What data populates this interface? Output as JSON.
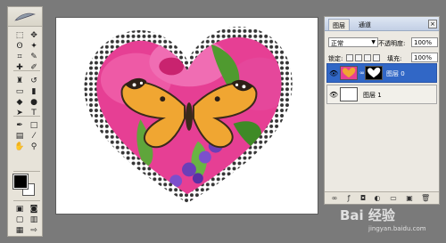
{
  "tools_panel": {
    "tools": [
      {
        "name": "marquee-tool",
        "glyph": "⬚"
      },
      {
        "name": "move-tool",
        "glyph": "✥"
      },
      {
        "name": "lasso-tool",
        "glyph": "ʘ"
      },
      {
        "name": "magic-wand-tool",
        "glyph": "✦"
      },
      {
        "name": "crop-tool",
        "glyph": "⌗"
      },
      {
        "name": "slice-tool",
        "glyph": "✎"
      },
      {
        "name": "healing-tool",
        "glyph": "✚"
      },
      {
        "name": "brush-tool",
        "glyph": "✐"
      },
      {
        "name": "stamp-tool",
        "glyph": "♜"
      },
      {
        "name": "history-brush-tool",
        "glyph": "↺"
      },
      {
        "name": "eraser-tool",
        "glyph": "▭"
      },
      {
        "name": "gradient-tool",
        "glyph": "▮"
      },
      {
        "name": "blur-tool",
        "glyph": "◆"
      },
      {
        "name": "dodge-tool",
        "glyph": "●"
      },
      {
        "name": "path-selection-tool",
        "glyph": "➤"
      },
      {
        "name": "type-tool",
        "glyph": "T"
      },
      {
        "name": "pen-tool",
        "glyph": "✒"
      },
      {
        "name": "shape-tool",
        "glyph": "□"
      },
      {
        "name": "notes-tool",
        "glyph": "▤"
      },
      {
        "name": "eyedropper-tool",
        "glyph": "⁄"
      },
      {
        "name": "hand-tool",
        "glyph": "✋"
      },
      {
        "name": "zoom-tool",
        "glyph": "⚲"
      },
      {
        "name": "quickmask-standard",
        "glyph": "▣"
      },
      {
        "name": "quickmask-mode",
        "glyph": "◙"
      },
      {
        "name": "screen-mode-1",
        "glyph": "▢"
      },
      {
        "name": "screen-mode-2",
        "glyph": "▥"
      },
      {
        "name": "screen-mode-3",
        "glyph": "▦"
      },
      {
        "name": "jump-to-imageready",
        "glyph": "⇨"
      }
    ],
    "foreground_color": "#000000",
    "background_color": "#ffffff"
  },
  "layers_panel": {
    "tabs": [
      "图层",
      "通道"
    ],
    "blend_mode": "正常",
    "opacity_label": "不透明度:",
    "opacity_value": "100%",
    "lock_label": "锁定:",
    "fill_label": "填充:",
    "fill_value": "100%",
    "layers": [
      {
        "name": "图层 0",
        "selected": true
      },
      {
        "name": "图层 1",
        "selected": false
      }
    ],
    "footer_icons": [
      "link-icon",
      "fx-icon",
      "mask-icon",
      "adjustment-icon",
      "group-icon",
      "new-layer-icon",
      "trash-icon"
    ]
  },
  "watermark": {
    "brand": "Bai 经验",
    "url": "jingyan.baidu.com"
  },
  "colors": {
    "selection_blue": "#3167c6",
    "panel_bg": "#ece9e2",
    "workspace_bg": "#7a7a7a"
  }
}
